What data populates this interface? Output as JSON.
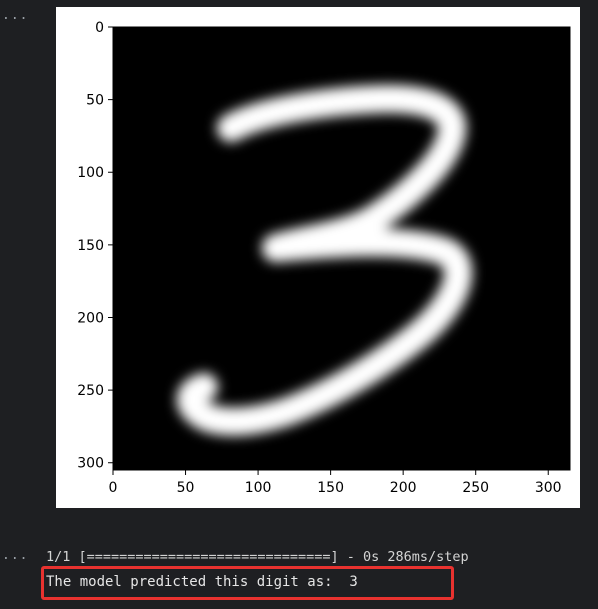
{
  "cell": {
    "ellipsis": "...",
    "progress_line": "1/1 [==============================] - 0s 286ms/step",
    "prediction_line": "The model predicted this digit as:  3"
  },
  "figure": {
    "image_description_digit": "3",
    "x_ticks": [
      "0",
      "50",
      "100",
      "150",
      "200",
      "250",
      "300"
    ],
    "y_ticks": [
      "0",
      "50",
      "100",
      "150",
      "200",
      "250",
      "300"
    ],
    "x_range": [
      0,
      315
    ],
    "y_range": [
      0,
      305
    ],
    "background_color": "#000000",
    "stroke_color": "#ffffff"
  },
  "highlight": {
    "color": "#e8322f"
  }
}
